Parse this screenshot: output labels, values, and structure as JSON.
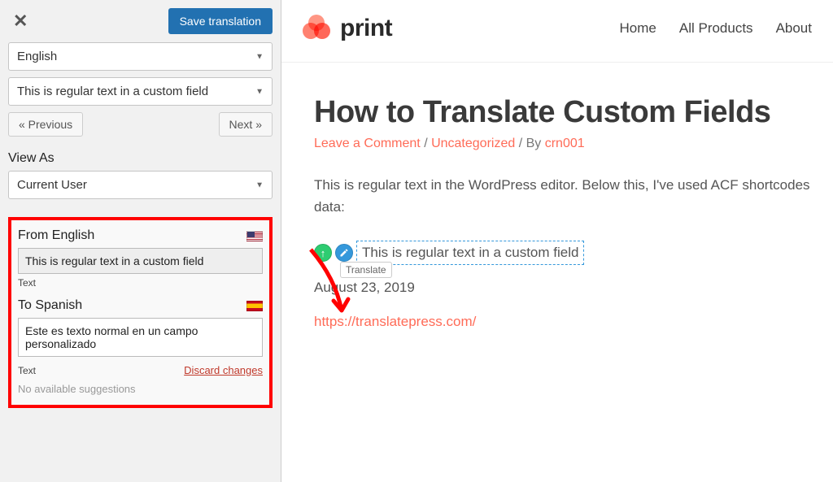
{
  "sidebar": {
    "save_button": "Save translation",
    "language_select": "English",
    "string_select": "This is regular text in a custom field",
    "prev": "« Previous",
    "next": "Next »",
    "view_as_label": "View As",
    "view_as_value": "Current User",
    "from_lang_label": "From English",
    "source_text": "This is regular text in a custom field",
    "type_label": "Text",
    "to_lang_label": "To Spanish",
    "translation_text": "Este es texto normal en un campo personalizado",
    "discard": "Discard changes",
    "no_suggestions": "No available suggestions"
  },
  "preview": {
    "brand": "print",
    "nav": {
      "home": "Home",
      "all": "All Products",
      "about": "About"
    },
    "title": "How to Translate Custom Fields",
    "meta": {
      "comment": "Leave a Comment",
      "category": "Uncategorized",
      "by": "By",
      "author": "crn001"
    },
    "body": "This is regular text in the WordPress editor. Below this, I've used ACF shortcodes data:",
    "custom_field_text": "This is regular text in a custom field",
    "tooltip": "Translate",
    "date": "August 23, 2019",
    "url": "https://translatepress.com/"
  }
}
